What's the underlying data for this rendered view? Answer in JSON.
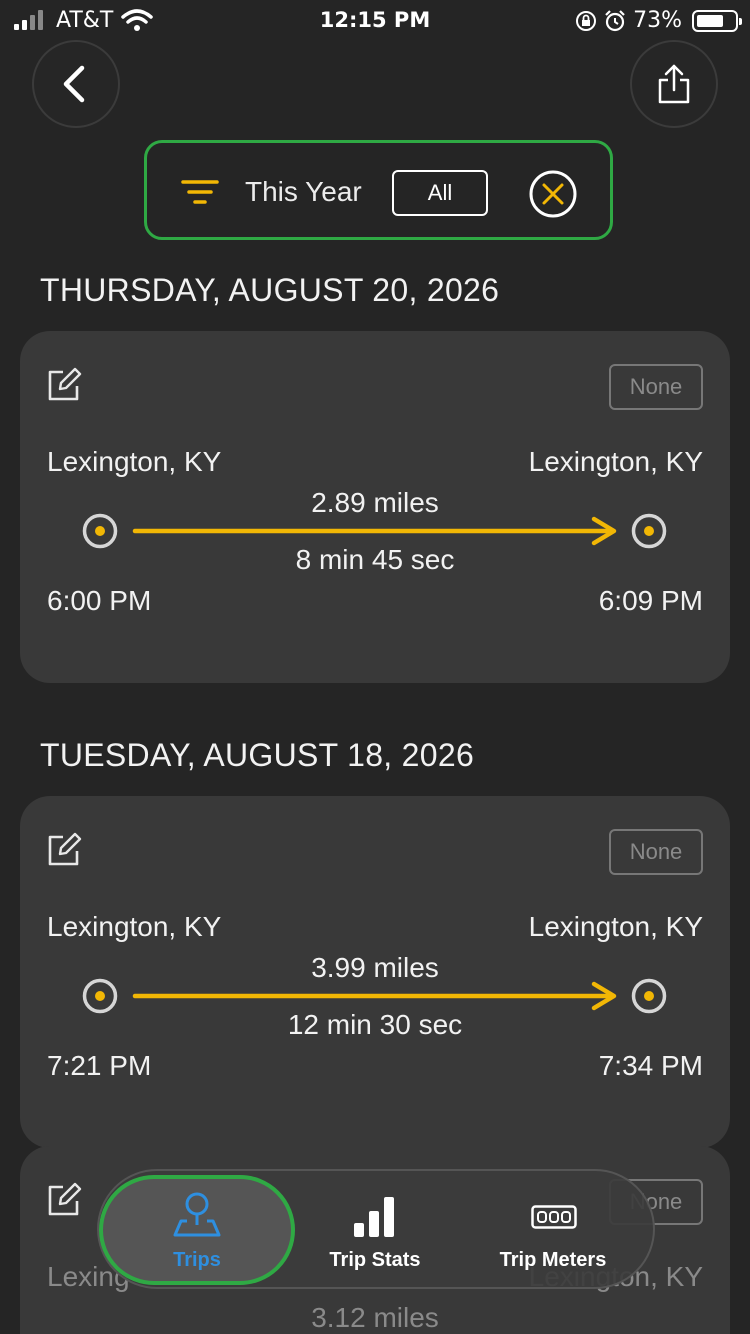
{
  "status_bar": {
    "carrier": "AT&T",
    "time": "12:15 PM",
    "battery": "73%",
    "battery_level": 0.73
  },
  "header": {
    "back_icon": "chevron-left-icon",
    "share_icon": "share-icon"
  },
  "filter": {
    "icon": "filter-icon",
    "label": "This Year",
    "all_label": "All",
    "clear_icon": "close-circle-icon",
    "accent": "#f2b705",
    "border": "#2fa944"
  },
  "trips": [
    {
      "date": "THURSDAY, AUGUST 20, 2026",
      "category": "None",
      "from": "Lexington, KY",
      "to": "Lexington, KY",
      "distance": "2.89 miles",
      "duration": "8 min 45 sec",
      "start_time": "6:00 PM",
      "end_time": "6:09 PM"
    },
    {
      "date": "TUESDAY, AUGUST 18, 2026",
      "category": "None",
      "from": "Lexington, KY",
      "to": "Lexington, KY",
      "distance": "3.99 miles",
      "duration": "12 min 30 sec",
      "start_time": "7:21 PM",
      "end_time": "7:34 PM"
    },
    {
      "category": "None",
      "from": "Lexing",
      "to": "Lexington, KY",
      "distance": "3.12 miles"
    }
  ],
  "tabs": [
    {
      "label": "Trips",
      "icon": "map-pin-icon",
      "active": true
    },
    {
      "label": "Trip Stats",
      "icon": "bar-chart-icon",
      "active": false
    },
    {
      "label": "Trip Meters",
      "icon": "odometer-icon",
      "active": false
    }
  ],
  "colors": {
    "background": "#252525",
    "card": "#393939",
    "route": "#f2b705",
    "active_tab": "#2e8fe0"
  }
}
